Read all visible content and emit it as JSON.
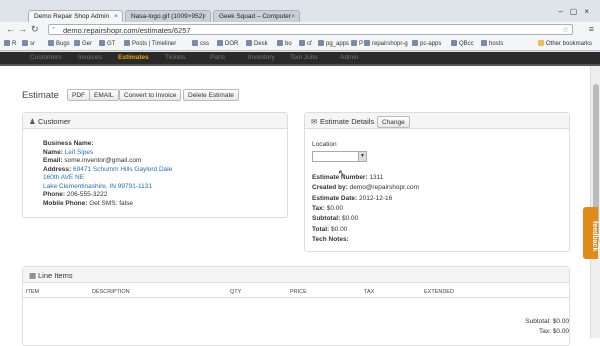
{
  "browser": {
    "tabs": [
      {
        "title": "Demo Repair Shop Admin"
      },
      {
        "title": "Nasa-logo.gif (1009×952)"
      },
      {
        "title": "Geek Squad – Computer"
      }
    ],
    "url": "demo.repairshopr.com/estimates/6257",
    "bookmarks": [
      "R",
      "sr",
      "Bugs",
      "Ger",
      "GT",
      "Posts | Timeliner",
      "css",
      "DOR",
      "Desk",
      "bo",
      "cf",
      "pg_apps",
      "P",
      "repairshopr-g",
      "pc-apps",
      "QBcc",
      "hosts",
      "Other bookmarks"
    ]
  },
  "app_nav": [
    "Customers",
    "Invoices",
    "Estimates",
    "Tickets",
    "Parts",
    "Inventory",
    "Tool Jobs",
    "Admin"
  ],
  "page": {
    "title": "Estimate",
    "buttons": [
      "PDF",
      "EMAIL",
      "Convert to Invoice",
      "Delete Estimate"
    ]
  },
  "customer": {
    "heading": "Customer",
    "business_label": "Business Name:",
    "name_label": "Name:",
    "name": "Leif Sipes",
    "email_label": "Email:",
    "email": "some.inventor@gmail.com",
    "address_label": "Address:",
    "address1": "69471 Schumm Hills Gaylord Dale",
    "address2": "160th AVE NE",
    "address3": "Lake Clementinashire, IN 99791-1131",
    "phone_label": "Phone:",
    "phone": "206-555-3222",
    "mobile_label": "Mobile Phone:",
    "mobile": "Get SMS: false"
  },
  "estimate": {
    "heading": "Estimate Details",
    "change_label": "Change",
    "location_label": "Location",
    "number_label": "Estimate Number:",
    "number": "1311",
    "created_label": "Created by:",
    "created": "demo@repairshopr.com",
    "date_label": "Estimate Date:",
    "date": "2012-12-16",
    "tax_label": "Tax:",
    "tax": "$0.00",
    "subtotal_label": "Subtotal:",
    "subtotal": "$0.00",
    "total_label": "Total:",
    "total": "$0.00",
    "notes_label": "Tech Notes:"
  },
  "line_items": {
    "heading": "Line Items",
    "columns": [
      "ITEM",
      "DESCRIPTION",
      "QTY",
      "PRICE",
      "TAX",
      "EXTENDED"
    ],
    "subtotal": "Subtotal: $0.00",
    "tax": "Tax: $0.00"
  },
  "feedback_label": "feedback",
  "colors": {
    "nav_active": "#f0a000",
    "feedback": "#e08a1a",
    "link": "#2a6fb5"
  }
}
